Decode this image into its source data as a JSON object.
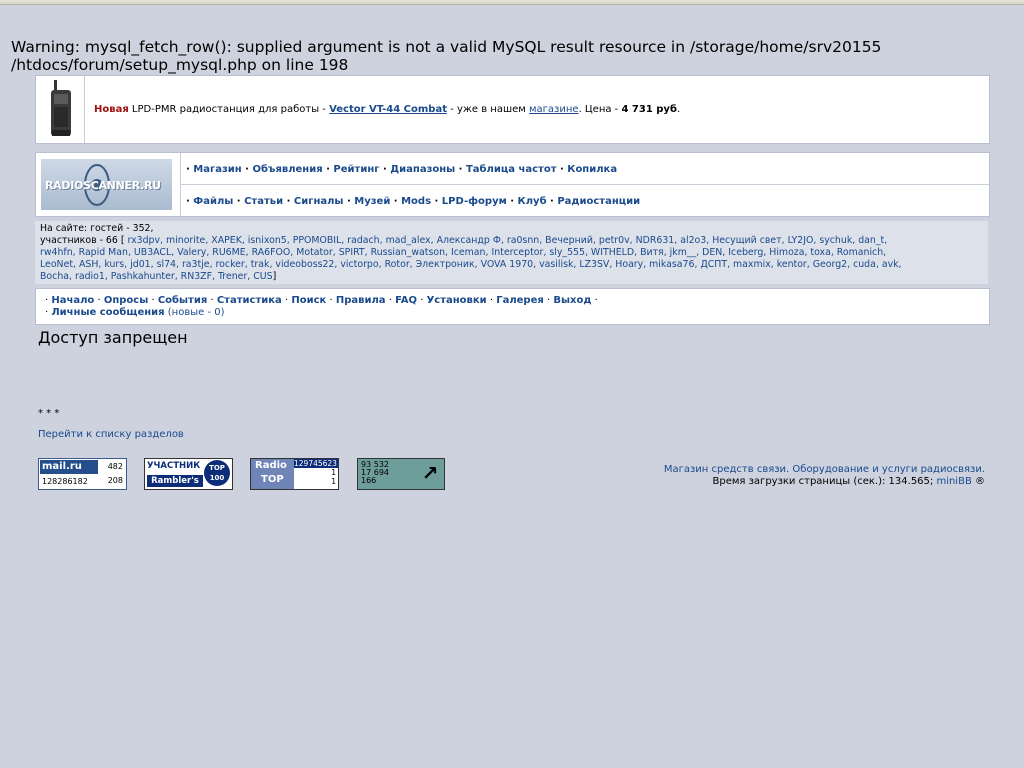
{
  "warning": {
    "label": "Warning",
    "message": ": mysql_fetch_row(): supplied argument is not a valid MySQL result resource in ",
    "path": "/storage/home/srv20155 /htdocs/forum/setup_mysql.php",
    "on_line": " on line ",
    "line": "198"
  },
  "ad": {
    "new": "Новая",
    "text1": " LPD-PMR радиостанция для работы - ",
    "product": "Vector VT-44 Combat",
    "text2": " - уже в нашем ",
    "shop": "магазине",
    "text3": ". Цена - ",
    "price": "4 731 руб",
    "end": "."
  },
  "logo": "RADIOSCANNER.RU",
  "nav": {
    "row1": [
      "Магазин",
      "Объявления",
      "Рейтинг",
      "Диапазоны",
      "Таблица частот",
      "Копилка"
    ],
    "row2": [
      "Файлы",
      "Статьи",
      "Сигналы",
      "Музей",
      "Mods",
      "LPD-форум",
      "Клуб",
      "Радиостанции"
    ]
  },
  "online": {
    "guests": "На сайте: гостей - 352,",
    "members_label": "участников - 66 [ ",
    "line2_users": "rx3dpv, minorite, XAPEK, isnixon5, PPOMOBIL, radach, mad_alex, Александр Ф, ra0snn, Вечерний, petr0v, NDR631, al2o3, Несущий свет, LY2JO, sychuk, dan_t,",
    "line3_users": "rw4hfn, Rapid Man, UB3ACL, Valery, RU6ME, RA6FOO, Motator, SPIRT, Russian_watson, Iceman, Interceptor, sly_555, WITHELD, Витя, jkm__, DEN, Iceberg, Himoza, toxa, Romanich,",
    "line4_users": "LeoNet, ASH, kurs, jd01, sl74, ra3tje, rocker, trak, videoboss22, victorpo, Rotor, Электроник, VOVA 1970, vasilisk, LZ3SV, Hoary, mikasa76, ДСПТ, maxmix, kentor, Georg2, cuda, avk,",
    "line5_users": "Bocha, radio1, Pashkahunter, RN3ZF, Trener, CUS",
    "close": "]"
  },
  "menu": {
    "items": [
      "Начало",
      "Опросы",
      "События",
      "Статистика",
      "Поиск",
      "Правила",
      "FAQ",
      "Установки",
      "Галерея",
      "Выход"
    ],
    "pm": "Личные сообщения",
    "pm_new": "(новые - 0)"
  },
  "main": {
    "title": "Доступ запрещен",
    "stars": "* * *",
    "goto": "Перейти к списку разделов"
  },
  "counters": {
    "mail": {
      "brand": "mail.ru",
      "n1": "482",
      "n2": "128286182",
      "n3": "208"
    },
    "rambler": {
      "t1": "УЧАСТНИК",
      "t2": "Rambler's",
      "badge": "TOP 100"
    },
    "radiotop": {
      "t1": "Radio",
      "t2": "TOP",
      "n1": "129745623",
      "n2": "1",
      "n3": "1"
    },
    "liveinternet": {
      "n1": "93 532",
      "n2": "17 694",
      "n3": "166",
      "arrow": "↗"
    }
  },
  "footer": {
    "shop_text": "Магазин средств связи. Оборудование и услуги радиосвязи.",
    "load_label": "Время загрузки страницы (сек.): 134.565; ",
    "minibb": "miniBB",
    "reg": " ®"
  }
}
